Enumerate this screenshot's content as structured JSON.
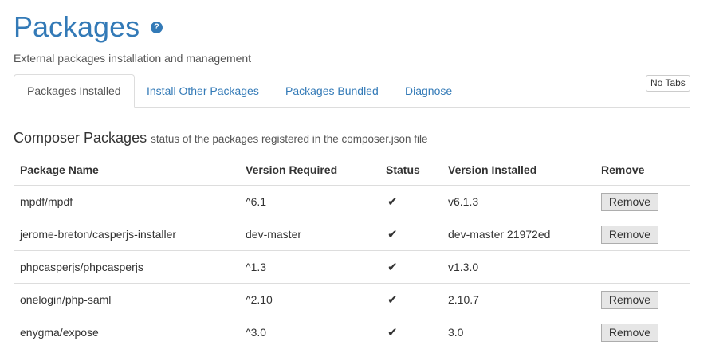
{
  "page": {
    "title": "Packages",
    "help_icon": "question-circle-icon",
    "subtitle": "External packages installation and management"
  },
  "tabs": [
    {
      "label": "Packages Installed",
      "active": true
    },
    {
      "label": "Install Other Packages",
      "active": false
    },
    {
      "label": "Packages Bundled",
      "active": false
    },
    {
      "label": "Diagnose",
      "active": false
    }
  ],
  "no_tabs_label": "No Tabs",
  "section": {
    "title": "Composer Packages",
    "description": "status of the packages registered in the composer.json file"
  },
  "table": {
    "headers": [
      "Package Name",
      "Version Required",
      "Status",
      "Version Installed",
      "Remove"
    ],
    "rows": [
      {
        "name": "mpdf/mpdf",
        "required": "^6.1",
        "status": "check-icon",
        "installed": "v6.1.3",
        "remove": "Remove"
      },
      {
        "name": "jerome-breton/casperjs-installer",
        "required": "dev-master",
        "status": "check-icon",
        "installed": "dev-master 21972ed",
        "remove": "Remove"
      },
      {
        "name": "phpcasperjs/phpcasperjs",
        "required": "^1.3",
        "status": "check-icon",
        "installed": "v1.3.0",
        "remove": ""
      },
      {
        "name": "onelogin/php-saml",
        "required": "^2.10",
        "status": "check-icon",
        "installed": "2.10.7",
        "remove": "Remove"
      },
      {
        "name": "enygma/expose",
        "required": "^3.0",
        "status": "check-icon",
        "installed": "3.0",
        "remove": "Remove"
      }
    ]
  },
  "colors": {
    "link": "#337ab7",
    "border": "#dddddd",
    "button_bg": "#e6e6e6"
  }
}
